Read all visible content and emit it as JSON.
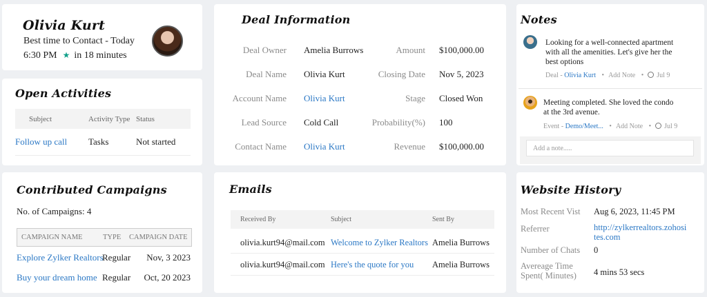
{
  "profile": {
    "name": "Olivia Kurt",
    "best_time_label": "Best time to Contact - Today",
    "time": "6:30 PM",
    "relative": "in 18 minutes"
  },
  "activities": {
    "title": "Open Activities",
    "columns": [
      "Subject",
      "Activity Type",
      "Status"
    ],
    "rows": [
      {
        "subject": "Follow up call",
        "type": "Tasks",
        "status": "Not started"
      }
    ]
  },
  "campaigns": {
    "title": "Contributed Campaigns",
    "count_label": "No. of Campaigns: 4",
    "columns": [
      "CAMPAIGN NAME",
      "TYPE",
      "CAMPAIGN DATE"
    ],
    "rows": [
      {
        "name": "Explore Zylker Realtors",
        "type": "Regular",
        "date": "Nov, 3 2023"
      },
      {
        "name": "Buy your dream home",
        "type": "Regular",
        "date": "Oct, 20 2023"
      }
    ]
  },
  "deal": {
    "title": "Deal Information",
    "fields": {
      "owner": {
        "label": "Deal Owner",
        "value": "Amelia Burrows"
      },
      "deal_name": {
        "label": "Deal Name",
        "value": "Olivia Kurt"
      },
      "account": {
        "label": "Account Name",
        "value": "Olivia Kurt"
      },
      "lead": {
        "label": "Lead Source",
        "value": "Cold Call"
      },
      "contact": {
        "label": "Contact Name",
        "value": "Olivia Kurt"
      },
      "amount": {
        "label": "Amount",
        "value": "$100,000.00"
      },
      "closing": {
        "label": "Closing Date",
        "value": "Nov 5, 2023"
      },
      "stage": {
        "label": "Stage",
        "value": "Closed Won"
      },
      "probability": {
        "label": "Probability(%)",
        "value": "100"
      },
      "revenue": {
        "label": "Revenue",
        "value": "$100,000.00"
      }
    }
  },
  "emails": {
    "title": "Emails",
    "columns": [
      "Received By",
      "Subject",
      "Sent By"
    ],
    "rows": [
      {
        "received": "olivia.kurt94@mail.com",
        "subject": "Welcome to Zylker Realtors",
        "sent": "Amelia Burrows"
      },
      {
        "received": "olivia.kurt94@mail.com",
        "subject": "Here's the quote for you",
        "sent": "Amelia Burrows"
      }
    ]
  },
  "notes": {
    "title": "Notes",
    "items": [
      {
        "text_lines": [
          "Looking for a well-connected apartment",
          "with all the amenities. Let's give her the",
          "best options"
        ],
        "meta_prefix": "Deal - ",
        "meta_link": "Olivia Kurt",
        "add_note": "Add Note",
        "date": "Jul 9"
      },
      {
        "text_lines": [
          "Meeting completed. She loved the condo",
          "at the 3rd avenue."
        ],
        "meta_prefix": "Event - ",
        "meta_link": "Demo/Meet...",
        "add_note": "Add Note",
        "date": "Jul 9"
      }
    ],
    "placeholder": "Add a note....."
  },
  "website": {
    "title": "Website History",
    "recent_label": "Most Recent Vist",
    "recent_value": "Aug 6, 2023, 11:45 PM",
    "referrer_label": "Referrer",
    "referrer_lines": [
      "http://zylkerrealtors.zohosi",
      "tes.com"
    ],
    "chats_label": "Number of Chats",
    "chats_value": "0",
    "avg_label_lines": [
      "Avereage Time",
      "Spent( Minutes)"
    ],
    "avg_value": "4 mins 53 secs"
  },
  "colors": {
    "link": "#2b78c5",
    "star": "#12a08a",
    "background": "#eef0f3"
  }
}
